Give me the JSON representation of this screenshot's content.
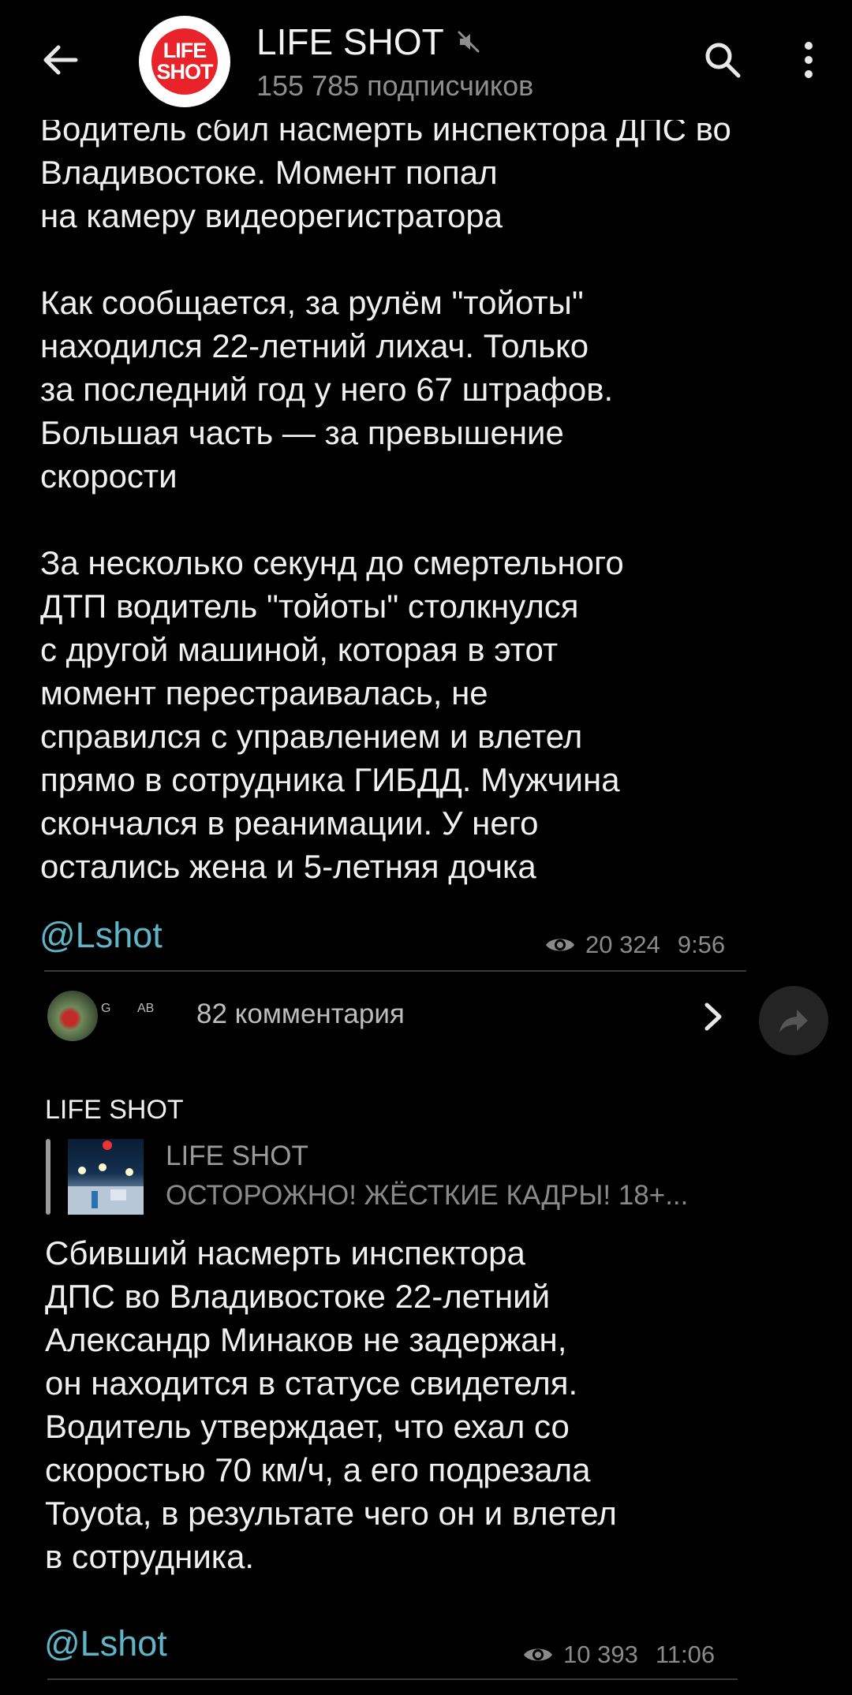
{
  "header": {
    "channel_name": "LIFE SHOT",
    "subscribers": "155 785 подписчиков",
    "avatar_line1": "LIFE",
    "avatar_line2": "SHOT"
  },
  "post1": {
    "text": "Водитель сбил насмерть инспектора ДПС во Владивостоке. Момент попал\nна камеру видеорегистратора\n\nКак сообщается, за рулём \"тойоты\"\nнаходился 22-летний лихач. Только\nза последний год у него 67 штрафов.\nБольшая часть — за превышение\nскорости\n\nЗа несколько секунд до смертельного\nДТП водитель \"тойоты\" столкнулся\nс другой машиной, которая в этот\nмомент перестраивалась, не\nсправился с управлением и влетел\nпрямо в сотрудника ГИБДД. Мужчина\nскончался в реанимации. У него\nостались жена и 5-летняя дочка",
    "link": "@Lshot",
    "views": "20 324",
    "time": "9:56",
    "commenter_a": "G",
    "commenter_b": "AB",
    "comments": "82 комментария"
  },
  "post2": {
    "sender": "LIFE SHOT",
    "reply_name": "LIFE SHOT",
    "reply_snippet": "ОСТОРОЖНО! ЖЁСТКИЕ КАДРЫ! 18+...",
    "text": "Сбивший насмерть инспектора\nДПС во Владивостоке 22-летний\nАлександр Минаков не задержан,\nон находится в статусе свидетеля.\nВодитель утверждает, что ехал со\nскоростью 70 км/ч, а его подрезала\nToyota, в результате чего он и влетел\nв сотрудника.",
    "link": "@Lshot",
    "views": "10 393",
    "time": "11:06"
  },
  "colors": {
    "background": "#000000",
    "link": "#5eb5c7",
    "avatar_red": "#e8242a",
    "muted_text": "#8a8a8a"
  },
  "icons": [
    "back-arrow-icon",
    "mute-icon",
    "search-icon",
    "more-vert-icon",
    "eye-icon",
    "chevron-right-icon",
    "share-icon"
  ]
}
